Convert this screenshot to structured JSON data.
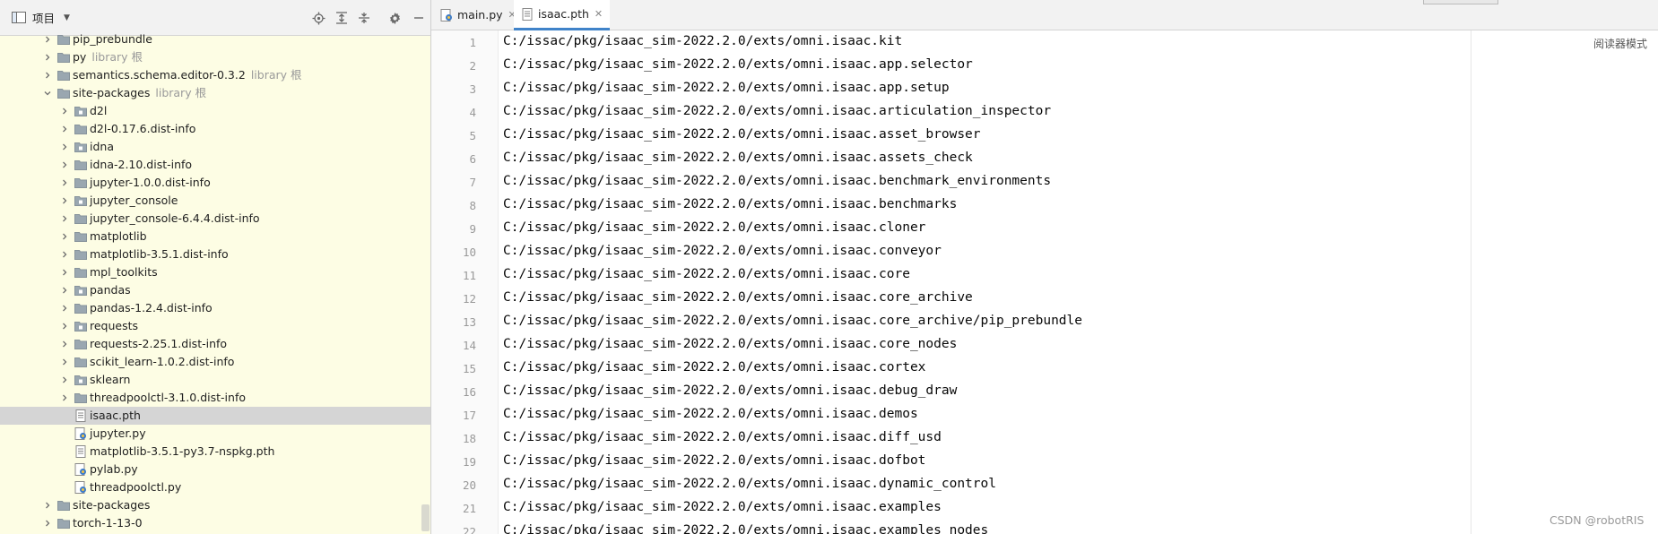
{
  "project_panel": {
    "title": "项目",
    "tree": [
      {
        "label": "pip_prebundle",
        "lib": "",
        "depth": 0,
        "kind": "folder",
        "expand": "closed"
      },
      {
        "label": "py",
        "lib": "library 根",
        "depth": 0,
        "kind": "folder",
        "expand": "closed"
      },
      {
        "label": "semantics.schema.editor-0.3.2",
        "lib": "library 根",
        "depth": 0,
        "kind": "folder",
        "expand": "closed"
      },
      {
        "label": "site-packages",
        "lib": "library 根",
        "depth": 0,
        "kind": "folder",
        "expand": "open"
      },
      {
        "label": "d2l",
        "lib": "",
        "depth": 1,
        "kind": "package",
        "expand": "closed"
      },
      {
        "label": "d2l-0.17.6.dist-info",
        "lib": "",
        "depth": 1,
        "kind": "folder",
        "expand": "closed"
      },
      {
        "label": "idna",
        "lib": "",
        "depth": 1,
        "kind": "package",
        "expand": "closed"
      },
      {
        "label": "idna-2.10.dist-info",
        "lib": "",
        "depth": 1,
        "kind": "folder",
        "expand": "closed"
      },
      {
        "label": "jupyter-1.0.0.dist-info",
        "lib": "",
        "depth": 1,
        "kind": "folder",
        "expand": "closed"
      },
      {
        "label": "jupyter_console",
        "lib": "",
        "depth": 1,
        "kind": "package",
        "expand": "closed"
      },
      {
        "label": "jupyter_console-6.4.4.dist-info",
        "lib": "",
        "depth": 1,
        "kind": "folder",
        "expand": "closed"
      },
      {
        "label": "matplotlib",
        "lib": "",
        "depth": 1,
        "kind": "folder",
        "expand": "closed"
      },
      {
        "label": "matplotlib-3.5.1.dist-info",
        "lib": "",
        "depth": 1,
        "kind": "folder",
        "expand": "closed"
      },
      {
        "label": "mpl_toolkits",
        "lib": "",
        "depth": 1,
        "kind": "folder",
        "expand": "closed"
      },
      {
        "label": "pandas",
        "lib": "",
        "depth": 1,
        "kind": "package",
        "expand": "closed"
      },
      {
        "label": "pandas-1.2.4.dist-info",
        "lib": "",
        "depth": 1,
        "kind": "folder",
        "expand": "closed"
      },
      {
        "label": "requests",
        "lib": "",
        "depth": 1,
        "kind": "package",
        "expand": "closed"
      },
      {
        "label": "requests-2.25.1.dist-info",
        "lib": "",
        "depth": 1,
        "kind": "folder",
        "expand": "closed"
      },
      {
        "label": "scikit_learn-1.0.2.dist-info",
        "lib": "",
        "depth": 1,
        "kind": "folder",
        "expand": "closed"
      },
      {
        "label": "sklearn",
        "lib": "",
        "depth": 1,
        "kind": "package",
        "expand": "closed"
      },
      {
        "label": "threadpoolctl-3.1.0.dist-info",
        "lib": "",
        "depth": 1,
        "kind": "folder",
        "expand": "closed"
      },
      {
        "label": "isaac.pth",
        "lib": "",
        "depth": 1,
        "kind": "textfile",
        "expand": "none",
        "selected": true
      },
      {
        "label": "jupyter.py",
        "lib": "",
        "depth": 1,
        "kind": "pyfile",
        "expand": "none"
      },
      {
        "label": "matplotlib-3.5.1-py3.7-nspkg.pth",
        "lib": "",
        "depth": 1,
        "kind": "textfile",
        "expand": "none"
      },
      {
        "label": "pylab.py",
        "lib": "",
        "depth": 1,
        "kind": "pyfile",
        "expand": "none"
      },
      {
        "label": "threadpoolctl.py",
        "lib": "",
        "depth": 1,
        "kind": "pyfile",
        "expand": "none"
      },
      {
        "label": "site-packages",
        "lib": "",
        "depth": 0,
        "kind": "folder",
        "expand": "closed"
      },
      {
        "label": "torch-1-13-0",
        "lib": "",
        "depth": 0,
        "kind": "folder",
        "expand": "closed"
      }
    ]
  },
  "editor": {
    "tabs": [
      {
        "label": "main.py",
        "icon": "python-file-icon",
        "active": false
      },
      {
        "label": "isaac.pth",
        "icon": "text-file-icon",
        "active": true
      }
    ],
    "reader_mode": "阅读器模式",
    "lines": [
      {
        "n": "1",
        "text": "C:/issac/pkg/isaac_sim-2022.2.0/exts/omni.isaac.kit"
      },
      {
        "n": "2",
        "text": "C:/issac/pkg/isaac_sim-2022.2.0/exts/omni.isaac.app.selector"
      },
      {
        "n": "3",
        "text": "C:/issac/pkg/isaac_sim-2022.2.0/exts/omni.isaac.app.setup"
      },
      {
        "n": "4",
        "text": "C:/issac/pkg/isaac_sim-2022.2.0/exts/omni.isaac.articulation_inspector"
      },
      {
        "n": "5",
        "text": "C:/issac/pkg/isaac_sim-2022.2.0/exts/omni.isaac.asset_browser"
      },
      {
        "n": "6",
        "text": "C:/issac/pkg/isaac_sim-2022.2.0/exts/omni.isaac.assets_check"
      },
      {
        "n": "7",
        "text": "C:/issac/pkg/isaac_sim-2022.2.0/exts/omni.isaac.benchmark_environments"
      },
      {
        "n": "8",
        "text": "C:/issac/pkg/isaac_sim-2022.2.0/exts/omni.isaac.benchmarks"
      },
      {
        "n": "9",
        "text": "C:/issac/pkg/isaac_sim-2022.2.0/exts/omni.isaac.cloner"
      },
      {
        "n": "10",
        "text": "C:/issac/pkg/isaac_sim-2022.2.0/exts/omni.isaac.conveyor"
      },
      {
        "n": "11",
        "text": "C:/issac/pkg/isaac_sim-2022.2.0/exts/omni.isaac.core"
      },
      {
        "n": "12",
        "text": "C:/issac/pkg/isaac_sim-2022.2.0/exts/omni.isaac.core_archive"
      },
      {
        "n": "13",
        "text": "C:/issac/pkg/isaac_sim-2022.2.0/exts/omni.isaac.core_archive/pip_prebundle"
      },
      {
        "n": "14",
        "text": "C:/issac/pkg/isaac_sim-2022.2.0/exts/omni.isaac.core_nodes"
      },
      {
        "n": "15",
        "text": "C:/issac/pkg/isaac_sim-2022.2.0/exts/omni.isaac.cortex"
      },
      {
        "n": "16",
        "text": "C:/issac/pkg/isaac_sim-2022.2.0/exts/omni.isaac.debug_draw"
      },
      {
        "n": "17",
        "text": "C:/issac/pkg/isaac_sim-2022.2.0/exts/omni.isaac.demos"
      },
      {
        "n": "18",
        "text": "C:/issac/pkg/isaac_sim-2022.2.0/exts/omni.isaac.diff_usd"
      },
      {
        "n": "19",
        "text": "C:/issac/pkg/isaac_sim-2022.2.0/exts/omni.isaac.dofbot"
      },
      {
        "n": "20",
        "text": "C:/issac/pkg/isaac_sim-2022.2.0/exts/omni.isaac.dynamic_control"
      },
      {
        "n": "21",
        "text": "C:/issac/pkg/isaac_sim-2022.2.0/exts/omni.isaac.examples"
      },
      {
        "n": "22",
        "text": "C:/issac/pkg/isaac_sim-2022.2.0/exts/omni.isaac.examples_nodes"
      }
    ]
  },
  "watermark": "CSDN @robotRIS",
  "colors": {
    "panel_bg": "#fdfde4",
    "selected_row": "#d5d5d5",
    "active_tab_underline": "#4083c9"
  }
}
